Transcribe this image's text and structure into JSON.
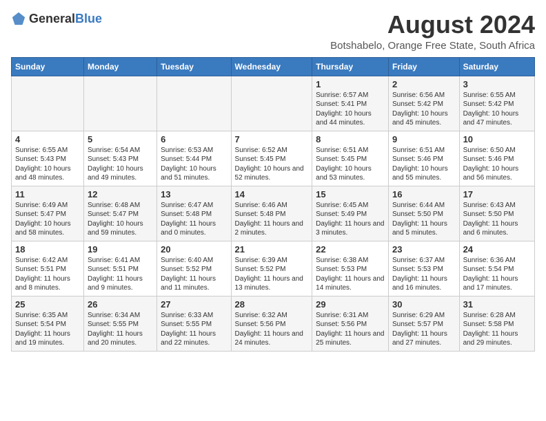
{
  "logo": {
    "general": "General",
    "blue": "Blue"
  },
  "title": "August 2024",
  "subtitle": "Botshabelo, Orange Free State, South Africa",
  "days": [
    "Sunday",
    "Monday",
    "Tuesday",
    "Wednesday",
    "Thursday",
    "Friday",
    "Saturday"
  ],
  "weeks": [
    [
      {
        "date": "",
        "info": ""
      },
      {
        "date": "",
        "info": ""
      },
      {
        "date": "",
        "info": ""
      },
      {
        "date": "",
        "info": ""
      },
      {
        "date": "1",
        "info": "Sunrise: 6:57 AM\nSunset: 5:41 PM\nDaylight: 10 hours and 44 minutes."
      },
      {
        "date": "2",
        "info": "Sunrise: 6:56 AM\nSunset: 5:42 PM\nDaylight: 10 hours and 45 minutes."
      },
      {
        "date": "3",
        "info": "Sunrise: 6:55 AM\nSunset: 5:42 PM\nDaylight: 10 hours and 47 minutes."
      }
    ],
    [
      {
        "date": "4",
        "info": "Sunrise: 6:55 AM\nSunset: 5:43 PM\nDaylight: 10 hours and 48 minutes."
      },
      {
        "date": "5",
        "info": "Sunrise: 6:54 AM\nSunset: 5:43 PM\nDaylight: 10 hours and 49 minutes."
      },
      {
        "date": "6",
        "info": "Sunrise: 6:53 AM\nSunset: 5:44 PM\nDaylight: 10 hours and 51 minutes."
      },
      {
        "date": "7",
        "info": "Sunrise: 6:52 AM\nSunset: 5:45 PM\nDaylight: 10 hours and 52 minutes."
      },
      {
        "date": "8",
        "info": "Sunrise: 6:51 AM\nSunset: 5:45 PM\nDaylight: 10 hours and 53 minutes."
      },
      {
        "date": "9",
        "info": "Sunrise: 6:51 AM\nSunset: 5:46 PM\nDaylight: 10 hours and 55 minutes."
      },
      {
        "date": "10",
        "info": "Sunrise: 6:50 AM\nSunset: 5:46 PM\nDaylight: 10 hours and 56 minutes."
      }
    ],
    [
      {
        "date": "11",
        "info": "Sunrise: 6:49 AM\nSunset: 5:47 PM\nDaylight: 10 hours and 58 minutes."
      },
      {
        "date": "12",
        "info": "Sunrise: 6:48 AM\nSunset: 5:47 PM\nDaylight: 10 hours and 59 minutes."
      },
      {
        "date": "13",
        "info": "Sunrise: 6:47 AM\nSunset: 5:48 PM\nDaylight: 11 hours and 0 minutes."
      },
      {
        "date": "14",
        "info": "Sunrise: 6:46 AM\nSunset: 5:48 PM\nDaylight: 11 hours and 2 minutes."
      },
      {
        "date": "15",
        "info": "Sunrise: 6:45 AM\nSunset: 5:49 PM\nDaylight: 11 hours and 3 minutes."
      },
      {
        "date": "16",
        "info": "Sunrise: 6:44 AM\nSunset: 5:50 PM\nDaylight: 11 hours and 5 minutes."
      },
      {
        "date": "17",
        "info": "Sunrise: 6:43 AM\nSunset: 5:50 PM\nDaylight: 11 hours and 6 minutes."
      }
    ],
    [
      {
        "date": "18",
        "info": "Sunrise: 6:42 AM\nSunset: 5:51 PM\nDaylight: 11 hours and 8 minutes."
      },
      {
        "date": "19",
        "info": "Sunrise: 6:41 AM\nSunset: 5:51 PM\nDaylight: 11 hours and 9 minutes."
      },
      {
        "date": "20",
        "info": "Sunrise: 6:40 AM\nSunset: 5:52 PM\nDaylight: 11 hours and 11 minutes."
      },
      {
        "date": "21",
        "info": "Sunrise: 6:39 AM\nSunset: 5:52 PM\nDaylight: 11 hours and 13 minutes."
      },
      {
        "date": "22",
        "info": "Sunrise: 6:38 AM\nSunset: 5:53 PM\nDaylight: 11 hours and 14 minutes."
      },
      {
        "date": "23",
        "info": "Sunrise: 6:37 AM\nSunset: 5:53 PM\nDaylight: 11 hours and 16 minutes."
      },
      {
        "date": "24",
        "info": "Sunrise: 6:36 AM\nSunset: 5:54 PM\nDaylight: 11 hours and 17 minutes."
      }
    ],
    [
      {
        "date": "25",
        "info": "Sunrise: 6:35 AM\nSunset: 5:54 PM\nDaylight: 11 hours and 19 minutes."
      },
      {
        "date": "26",
        "info": "Sunrise: 6:34 AM\nSunset: 5:55 PM\nDaylight: 11 hours and 20 minutes."
      },
      {
        "date": "27",
        "info": "Sunrise: 6:33 AM\nSunset: 5:55 PM\nDaylight: 11 hours and 22 minutes."
      },
      {
        "date": "28",
        "info": "Sunrise: 6:32 AM\nSunset: 5:56 PM\nDaylight: 11 hours and 24 minutes."
      },
      {
        "date": "29",
        "info": "Sunrise: 6:31 AM\nSunset: 5:56 PM\nDaylight: 11 hours and 25 minutes."
      },
      {
        "date": "30",
        "info": "Sunrise: 6:29 AM\nSunset: 5:57 PM\nDaylight: 11 hours and 27 minutes."
      },
      {
        "date": "31",
        "info": "Sunrise: 6:28 AM\nSunset: 5:58 PM\nDaylight: 11 hours and 29 minutes."
      }
    ]
  ]
}
